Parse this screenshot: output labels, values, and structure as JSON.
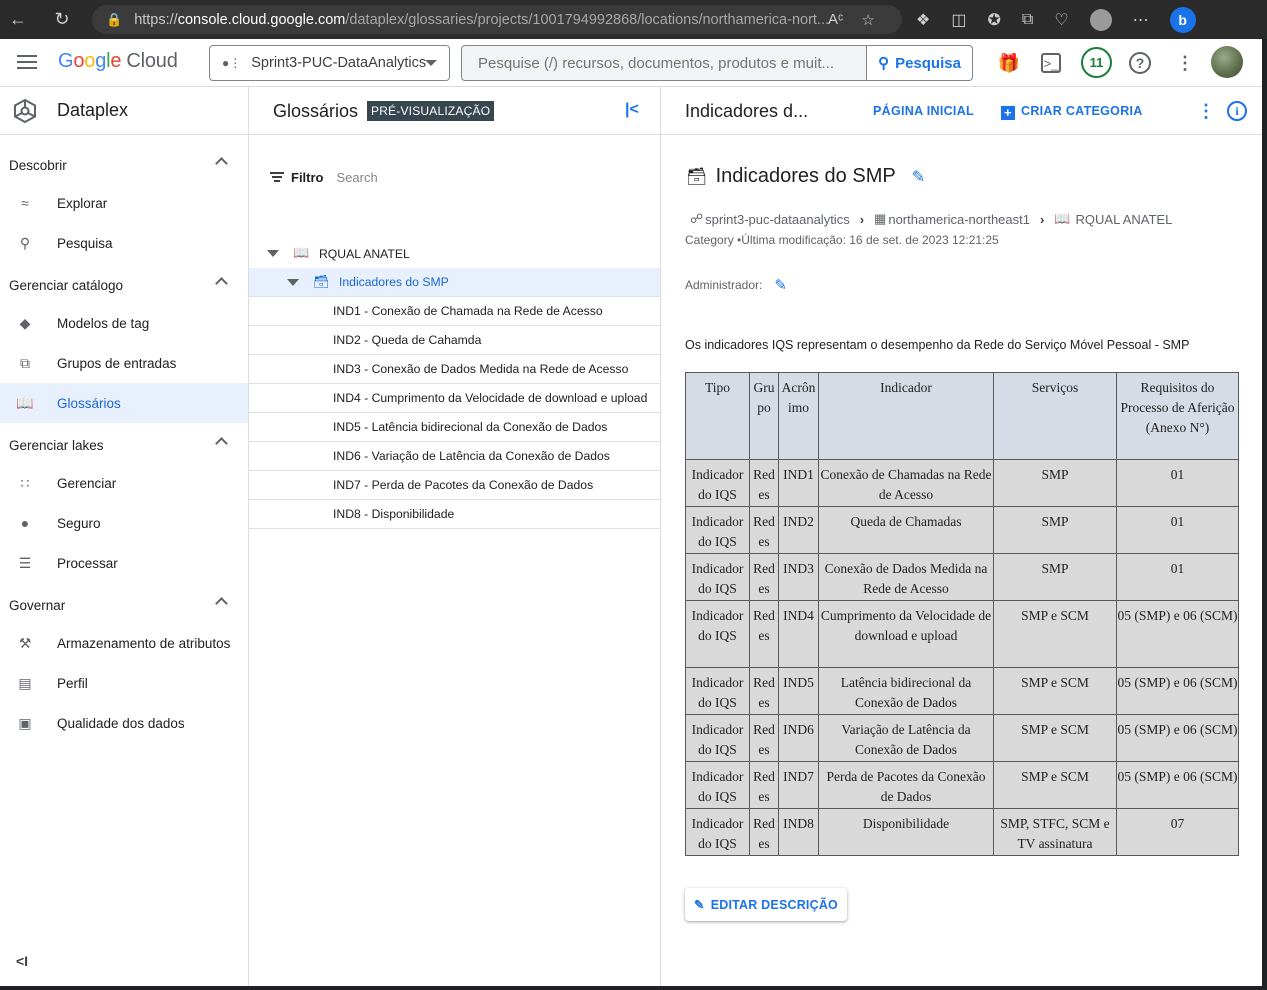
{
  "browser": {
    "url_scheme": "https://",
    "url_domain": "console.cloud.google.com",
    "url_path": "/dataplex/glossaries/projects/1001794992868/locations/northamerica-nort..."
  },
  "header": {
    "logo_google": [
      "G",
      "o",
      "o",
      "g",
      "l",
      "e"
    ],
    "logo_cloud": "Cloud",
    "project": "Sprint3-PUC-DataAnalytics",
    "search_placeholder": "Pesquise (/) recursos, documentos, produtos e muit...",
    "search_button": "Pesquisa",
    "notifications": "11"
  },
  "leftnav": {
    "product": "Dataplex",
    "sections": [
      {
        "label": "Descobrir",
        "items": [
          {
            "label": "Explorar",
            "icon": "explore-icon"
          },
          {
            "label": "Pesquisa",
            "icon": "search-icon"
          }
        ]
      },
      {
        "label": "Gerenciar catálogo",
        "items": [
          {
            "label": "Modelos de tag",
            "icon": "tag-icon"
          },
          {
            "label": "Grupos de entradas",
            "icon": "entry-groups-icon"
          },
          {
            "label": "Glossários",
            "icon": "book-icon"
          }
        ]
      },
      {
        "label": "Gerenciar lakes",
        "items": [
          {
            "label": "Gerenciar",
            "icon": "grid-icon"
          },
          {
            "label": "Seguro",
            "icon": "person-icon"
          },
          {
            "label": "Processar",
            "icon": "list-icon"
          }
        ]
      },
      {
        "label": "Governar",
        "items": [
          {
            "label": "Armazenamento de atributos",
            "icon": "gavel-icon"
          },
          {
            "label": "Perfil",
            "icon": "profile-icon"
          },
          {
            "label": "Qualidade dos dados",
            "icon": "quality-icon"
          }
        ]
      }
    ]
  },
  "glossary": {
    "title": "Glossários",
    "badge": "PRÉ-VISUALIZAÇÃO",
    "filter_label": "Filtro",
    "filter_placeholder": "Search",
    "root": "RQUAL ANATEL",
    "category": "Indicadores do SMP",
    "terms": [
      "IND1 - Conexão de Chamada na Rede de Acesso",
      "IND2 - Queda de Cahamda",
      "IND3 - Conexão de Dados Medida na Rede de Acesso",
      "IND4 - Cumprimento da Velocidade de download e upload",
      "IND5 - Latência bidirecional da Conexão de Dados",
      "IND6 - Variação de Latência da Conexão de Dados",
      "IND7 - Perda de Pacotes da Conexão de Dados",
      "IND8 - Disponibilidade"
    ]
  },
  "detail": {
    "header_title": "Indicadores d...",
    "home_link": "PÁGINA INICIAL",
    "create_link": "CRIAR CATEGORIA",
    "title": "Indicadores do SMP",
    "crumbs": [
      "sprint3-puc-dataanalytics",
      "northamerica-northeast1",
      "RQUAL ANATEL"
    ],
    "meta": "Category •Última modificação: 16 de set. de 2023 12:21:25",
    "admin": "Administrador:",
    "description": "Os indicadores IQS representam o desempenho da Rede do Serviço Móvel Pessoal - SMP",
    "table": {
      "headers": [
        "Tipo",
        "Gru po",
        "Acrôn imo",
        "Indicador",
        "Serviços",
        "Requisitos do Processo de Aferição (Anexo N°)"
      ],
      "rows": [
        [
          "Indicador do IQS",
          "Red es",
          "IND1",
          "Conexão de Chamadas na Rede de Acesso",
          "SMP",
          "01"
        ],
        [
          "Indicador do IQS",
          "Red es",
          "IND2",
          "Queda de Chamadas",
          "SMP",
          "01"
        ],
        [
          "Indicador do IQS",
          "Red es",
          "IND3",
          "Conexão de Dados Medida na Rede de Acesso",
          "SMP",
          "01"
        ],
        [
          "Indicador do IQS",
          "Red es",
          "IND4",
          "Cumprimento da Velocidade de download e upload",
          "SMP e SCM",
          "05 (SMP) e 06 (SCM)"
        ],
        [
          "Indicador do IQS",
          "Red es",
          "IND5",
          "Latência bidirecional da Conexão de Dados",
          "SMP e SCM",
          "05 (SMP) e 06 (SCM)"
        ],
        [
          "Indicador do IQS",
          "Red es",
          "IND6",
          "Variação de Latência da Conexão de Dados",
          "SMP e SCM",
          "05 (SMP) e 06 (SCM)"
        ],
        [
          "Indicador do IQS",
          "Red es",
          "IND7",
          "Perda de Pacotes da Conexão de Dados",
          "SMP e SCM",
          "05 (SMP) e 06 (SCM)"
        ],
        [
          "Indicador do IQS",
          "Red es",
          "IND8",
          "Disponibilidade",
          "SMP, STFC, SCM e TV assinatura",
          "07"
        ]
      ]
    },
    "edit_button": "EDITAR DESCRIÇÃO"
  },
  "colors": {
    "accent": "#1a73e8",
    "selected_bg": "#e8f0fe",
    "table_header": "#d6dce5",
    "table_body": "#d9d9d9"
  }
}
